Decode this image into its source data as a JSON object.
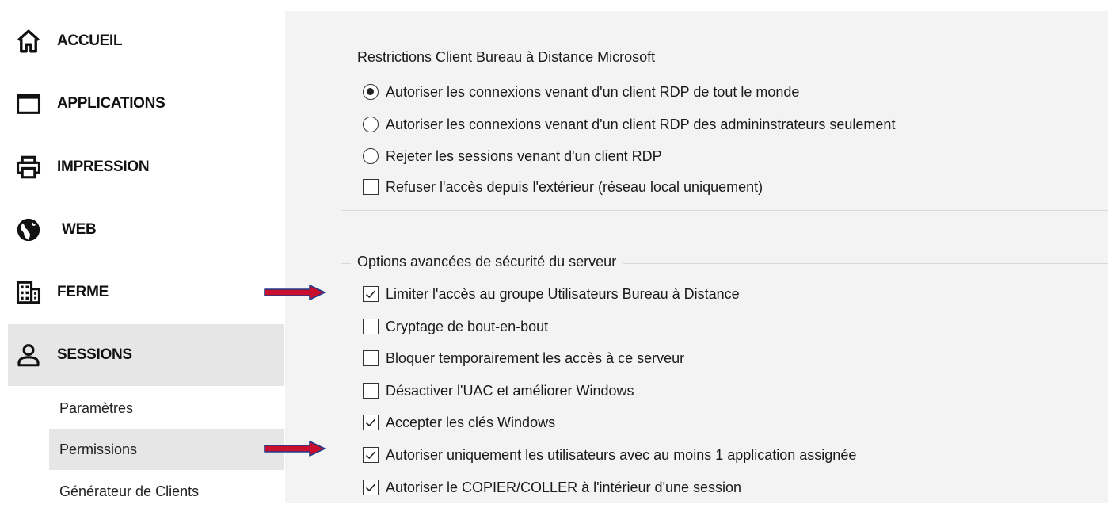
{
  "sidebar": {
    "items": [
      {
        "label": "ACCUEIL",
        "icon": "home-icon"
      },
      {
        "label": "APPLICATIONS",
        "icon": "window-icon"
      },
      {
        "label": "IMPRESSION",
        "icon": "printer-icon"
      },
      {
        "label": "WEB",
        "icon": "globe-icon"
      },
      {
        "label": "FERME",
        "icon": "building-icon"
      },
      {
        "label": "SESSIONS",
        "icon": "user-icon",
        "active": true
      }
    ],
    "sub_items": [
      {
        "label": "Paramètres"
      },
      {
        "label": "Permissions",
        "active": true
      },
      {
        "label": "Générateur de Clients"
      }
    ]
  },
  "rdp_group": {
    "title": "Restrictions Client Bureau à Distance Microsoft",
    "options": [
      {
        "type": "radio",
        "label": "Autoriser les connexions venant d'un client RDP de tout le monde",
        "checked": true
      },
      {
        "type": "radio",
        "label": "Autoriser les connexions venant d'un client RDP des admininstrateurs seulement",
        "checked": false
      },
      {
        "type": "radio",
        "label": "Rejeter les sessions venant d'un client RDP",
        "checked": false
      },
      {
        "type": "checkbox",
        "label": "Refuser l'accès depuis l'extérieur (réseau local uniquement)",
        "checked": false
      }
    ]
  },
  "security_group": {
    "title": "Options avancées de sécurité du serveur",
    "options": [
      {
        "type": "checkbox",
        "label": "Limiter l'accès au groupe Utilisateurs Bureau à Distance",
        "checked": true
      },
      {
        "type": "checkbox",
        "label": "Cryptage de bout-en-bout",
        "checked": false
      },
      {
        "type": "checkbox",
        "label": "Bloquer temporairement les accès à ce serveur",
        "checked": false
      },
      {
        "type": "checkbox",
        "label": "Désactiver l'UAC et améliorer Windows",
        "checked": false
      },
      {
        "type": "checkbox",
        "label": "Accepter les clés Windows",
        "checked": true
      },
      {
        "type": "checkbox",
        "label": "Autoriser uniquement les utilisateurs avec au moins 1 application assignée",
        "checked": true
      },
      {
        "type": "checkbox",
        "label": "Autoriser le COPIER/COLLER à l'intérieur d'une session",
        "checked": true
      }
    ]
  },
  "colors": {
    "active_bg": "#e6e6e6",
    "panel_bg": "#f3f3f3",
    "arrow_fill": "#c8102e",
    "arrow_outline": "#1f3a8a"
  }
}
